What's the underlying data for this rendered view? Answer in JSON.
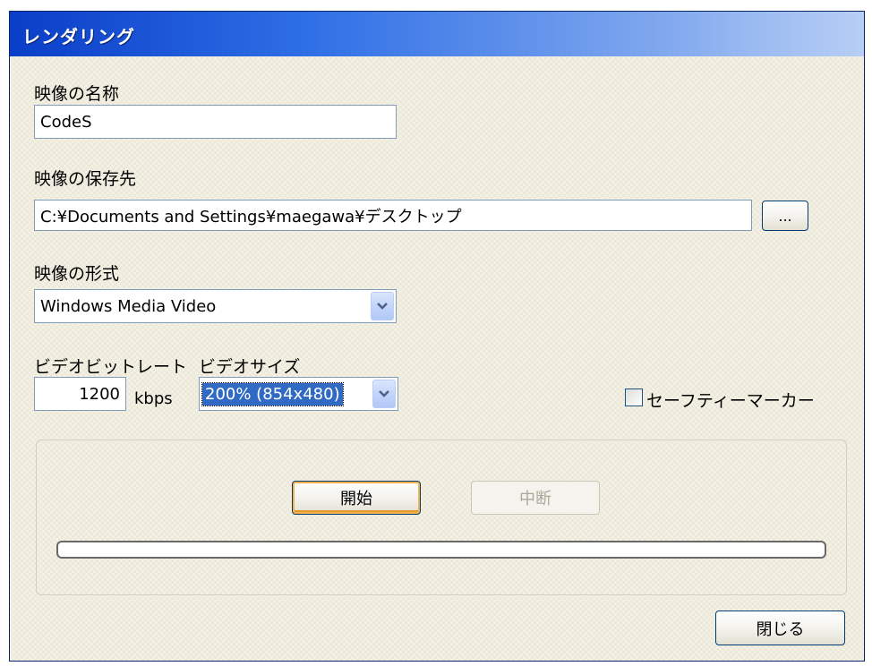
{
  "window": {
    "title": "レンダリング"
  },
  "video_name": {
    "label": "映像の名称",
    "value": "CodeS"
  },
  "save_location": {
    "label": "映像の保存先",
    "value": "C:¥Documents and Settings¥maegawa¥デスクトップ",
    "browse_label": "..."
  },
  "video_format": {
    "label": "映像の形式",
    "selected": "Windows Media Video"
  },
  "bitrate": {
    "label": "ビデオビットレート",
    "value": "1200",
    "unit": "kbps"
  },
  "video_size": {
    "label": "ビデオサイズ",
    "selected": "200% (854x480)"
  },
  "safety_marker": {
    "label": "セーフティーマーカー",
    "checked": false
  },
  "actions": {
    "start_label": "開始",
    "stop_label": "中断",
    "progress_fraction": 0
  },
  "footer": {
    "close_label": "閉じる"
  }
}
